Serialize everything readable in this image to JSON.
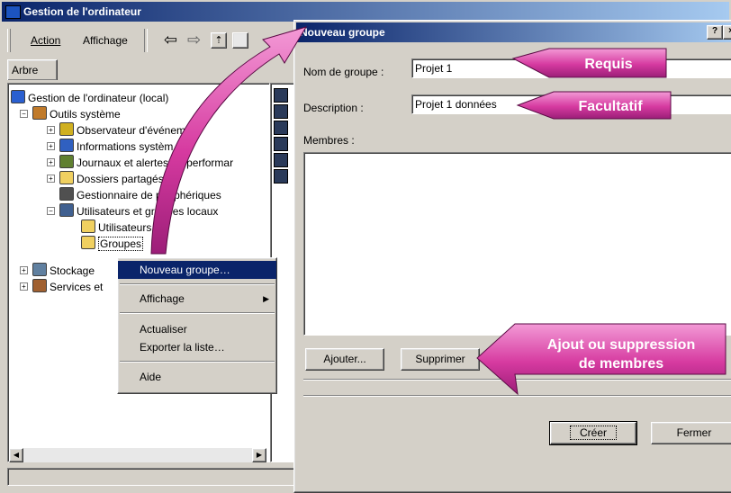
{
  "main_window": {
    "title": "Gestion de l'ordinateur",
    "menu": {
      "action": "Action",
      "view": "Affichage"
    },
    "tab": "Arbre"
  },
  "tree": [
    {
      "label": "Gestion de l'ordinateur (local)",
      "icon": "computer-icon"
    },
    {
      "label": "Outils système",
      "icon": "tools-icon"
    },
    {
      "label": "Observateur d'événem",
      "icon": "event-viewer-icon"
    },
    {
      "label": "Informations systèm",
      "icon": "system-info-icon"
    },
    {
      "label": "Journaux et alertes de performar",
      "icon": "logs-icon"
    },
    {
      "label": "Dossiers partagés",
      "icon": "folder-icon"
    },
    {
      "label": "Gestionnaire de périphériques",
      "icon": "device-manager-icon"
    },
    {
      "label": "Utilisateurs et groupes locaux",
      "icon": "users-icon"
    },
    {
      "label": "Utilisateurs",
      "icon": "folder-icon"
    },
    {
      "label": "Groupes",
      "icon": "folder-open-icon"
    },
    {
      "label": "Stockage",
      "icon": "storage-icon"
    },
    {
      "label": "Services et",
      "icon": "services-icon"
    }
  ],
  "context_menu": {
    "items": [
      "Nouveau groupe…",
      "Affichage",
      "Actualiser",
      "Exporter la liste…",
      "Aide"
    ]
  },
  "dialog": {
    "title": "Nouveau groupe",
    "help_btn": "?",
    "close_btn": "×",
    "name_label": "Nom de groupe :",
    "name_value": "Projet 1",
    "desc_label": "Description :",
    "desc_value": "Projet 1 données",
    "members_label": "Membres :",
    "add_label": "Ajouter...",
    "remove_label": "Supprimer",
    "create_label": "Créer",
    "close_label": "Fermer"
  },
  "callouts": {
    "required": "Requis",
    "optional": "Facultatif",
    "members_line1": "Ajout ou suppression",
    "members_line2": "de membres"
  },
  "colors": {
    "callout_pink": "#e040a8",
    "title_blue": "#0a246a",
    "selection": "#0a246a"
  }
}
